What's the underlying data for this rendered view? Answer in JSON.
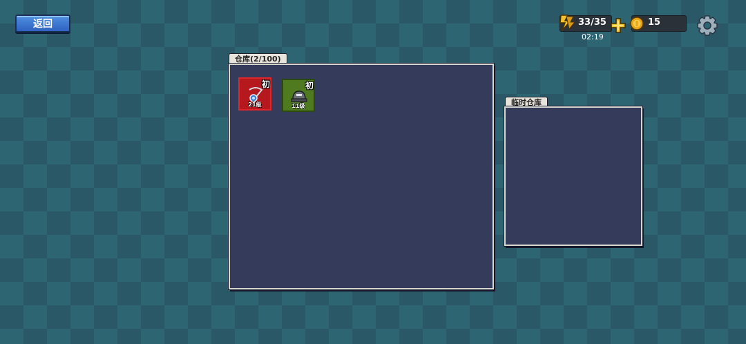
{
  "header": {
    "back_label": "返回"
  },
  "hud": {
    "energy": "33/35",
    "energy_timer": "02:19",
    "coins": "15",
    "icons": [
      "energy-icon",
      "add-icon",
      "coin-icon",
      "gear-icon"
    ]
  },
  "warehouse": {
    "title": "仓库(2/100)",
    "items": [
      {
        "grade": "初",
        "level": "21级",
        "icon": "amulet-icon",
        "rarity_color": "#b5191d"
      },
      {
        "grade": "初",
        "level": "11级",
        "icon": "helmet-icon",
        "rarity_color": "#4f7a1f"
      }
    ]
  },
  "temp_warehouse": {
    "title": "临时仓库"
  }
}
